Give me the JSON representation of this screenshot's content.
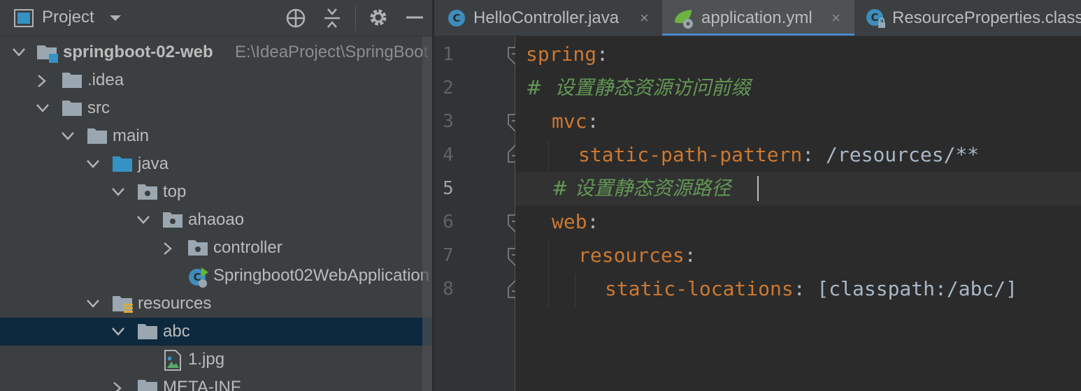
{
  "project_panel": {
    "title": "Project",
    "tree": [
      {
        "label": "springboot-02-web",
        "path": "E:\\IdeaProject\\SpringBoot"
      },
      {
        "label": ".idea"
      },
      {
        "label": "src"
      },
      {
        "label": "main"
      },
      {
        "label": "java"
      },
      {
        "label": "top"
      },
      {
        "label": "ahaoao"
      },
      {
        "label": "controller"
      },
      {
        "label": "Springboot02WebApplication"
      },
      {
        "label": "resources"
      },
      {
        "label": "abc"
      },
      {
        "label": "1.jpg"
      },
      {
        "label": "META-INF"
      }
    ]
  },
  "tabs": [
    {
      "label": "HelloController.java",
      "close": "×"
    },
    {
      "label": "application.yml",
      "close": "×"
    },
    {
      "label": "ResourceProperties.class"
    }
  ],
  "editor": {
    "line_numbers": [
      "1",
      "2",
      "3",
      "4",
      "5",
      "6",
      "7",
      "8"
    ],
    "lines": {
      "l1_key": "spring",
      "l1_colon": ":",
      "l2_comment": "#  设置静态资源访问前缀",
      "l3_key": "mvc",
      "l3_colon": ":",
      "l4_key": "static-path-pattern",
      "l4_rest": ": /resources/**",
      "l5_comment": "# 设置静态资源路径",
      "l6_key": "web",
      "l6_colon": ":",
      "l7_key": "resources",
      "l7_colon": ":",
      "l8_key": "static-locations",
      "l8_rest": ": [classpath:/abc/]"
    }
  },
  "colors": {
    "key": "#cc7832",
    "value": "#a9b7c6",
    "comment": "#629755",
    "selection": "#0d293e",
    "active_tab_underline": "#4a88c7"
  }
}
